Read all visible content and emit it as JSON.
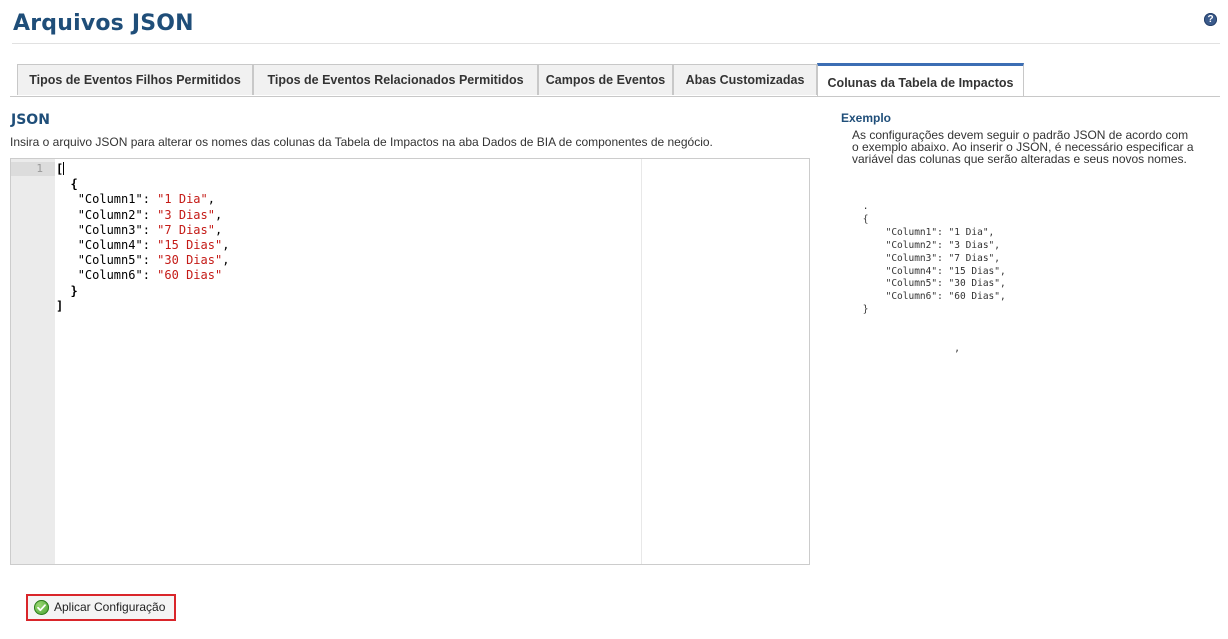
{
  "page": {
    "title": "Arquivos JSON",
    "help_icon": "question-circle-icon",
    "accent_color": "#1f4e79",
    "active_tab_color": "#3c6eb4"
  },
  "tabs": [
    {
      "label": "Tipos de Eventos Filhos Permitidos",
      "active": false
    },
    {
      "label": "Tipos de Eventos Relacionados Permitidos",
      "active": false
    },
    {
      "label": "Campos de Eventos",
      "active": false
    },
    {
      "label": "Abas Customizadas",
      "active": false
    },
    {
      "label": "Colunas da Tabela de Impactos",
      "active": true
    }
  ],
  "json_section": {
    "heading": "JSON",
    "description": "Insira o arquivo JSON para alterar os nomes das colunas da Tabela de Impactos na aba Dados de BIA de componentes de negócio.",
    "editor": {
      "line_number": "1",
      "lines": [
        {
          "key": "\"Column1\"",
          "value": "\"1 Dia\""
        },
        {
          "key": "\"Column2\"",
          "value": "\"3 Dias\""
        },
        {
          "key": "\"Column3\"",
          "value": "\"7 Dias\""
        },
        {
          "key": "\"Column4\"",
          "value": "\"15 Dias\""
        },
        {
          "key": "\"Column5\"",
          "value": "\"30 Dias\""
        },
        {
          "key": "\"Column6\"",
          "value": "\"60 Dias\""
        }
      ]
    }
  },
  "example": {
    "heading": "Exemplo",
    "description": "As configurações devem seguir o padrão JSON de acordo com o exemplo abaixo. Ao inserir o JSON, é necessário especificar a variável das colunas que serão alteradas e seus novos nomes.",
    "code": " .\n {\n     \"Column1\": \"1 Dia\",\n     \"Column2\": \"3 Dias\",\n     \"Column3\": \"7 Dias\",\n     \"Column4\": \"15 Dias\",\n     \"Column5\": \"30 Dias\",\n     \"Column6\": \"60 Dias\",\n }\n\n\n                 ,"
  },
  "actions": {
    "apply_label": "Aplicar Configuração",
    "apply_icon": "check-circle-icon",
    "apply_border_color": "#d9252a"
  }
}
